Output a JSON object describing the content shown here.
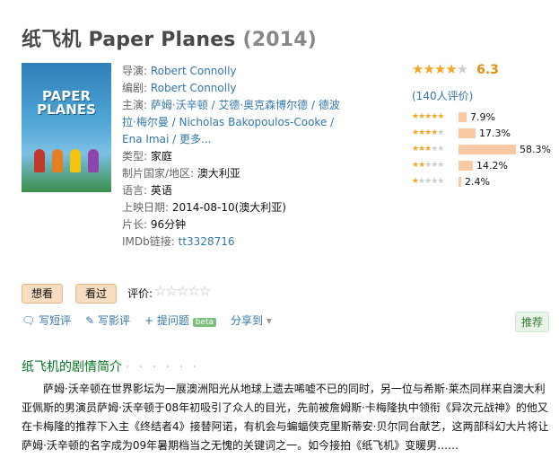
{
  "movie": {
    "title": "纸飞机 Paper Planes",
    "year": "(2014)",
    "poster": {
      "text_line1": "PAPER",
      "text_line2": "PLANES"
    }
  },
  "info": {
    "director_label": "导演:",
    "director": "Robert Connolly",
    "writer_label": "编剧:",
    "writer": "Robert Connolly",
    "cast_label": "主演:",
    "cast_text": "萨姆·沃辛顿 / 艾德·奥克森博尔德 / 德波拉·梅尔曼 / Nicholas Bakopoulos-Cooke / Ena Imai / 更多...",
    "genre_label": "类型:",
    "genre": "家庭",
    "region_label": "制片国家/地区:",
    "region": "澳大利亚",
    "language_label": "语言:",
    "language": "英语",
    "release_label": "上映日期:",
    "release": "2014-08-10(澳大利亚)",
    "runtime_label": "片长:",
    "runtime": "96分钟",
    "imdb_label": "IMDb链接:",
    "imdb": "tt3328716"
  },
  "rating": {
    "score": "6.3",
    "count_text": "(140人评价)",
    "bars": [
      {
        "pct": "7.9%",
        "value": 7.9
      },
      {
        "pct": "17.3%",
        "value": 17.3
      },
      {
        "pct": "58.3%",
        "value": 58.3
      },
      {
        "pct": "14.2%",
        "value": 14.2
      },
      {
        "pct": "2.4%",
        "value": 2.4
      }
    ]
  },
  "buttons": {
    "want": "想看",
    "seen": "看过",
    "rate_label": "评价:"
  },
  "actions": {
    "short_review": "写短评",
    "review": "写影评",
    "question": "提问题",
    "beta": "beta",
    "share": "分享到",
    "recommend": "推荐"
  },
  "synopsis": {
    "heading": "纸飞机的剧情简介",
    "dots": "· · · · · ·",
    "text": "萨姆·沃辛顿在世界影坛为一展澳洲阳光从地球上遗去唏嘘不已的同时，另一位与希斯·莱杰同样来自澳大利亚佩斯的男演员萨姆·沃辛顿于08年初吸引了众人的目光，先前被詹姆斯·卡梅隆执中领衔《异次元战神》的他又在卡梅隆的推荐下入主《终结者4》接替阿诺，有机会与蝙蝠侠克里斯蒂安·贝尔同台献艺，这两部科幻大片将让萨姆·沃辛顿的名字成为09年暑期档当之无愧的关键词之一。如今接拍《纸飞机》变暖男……"
  },
  "colors": {
    "link": "#37a",
    "accent": "#007722",
    "bar": "#f8c9a3",
    "star": "#f5a623"
  }
}
